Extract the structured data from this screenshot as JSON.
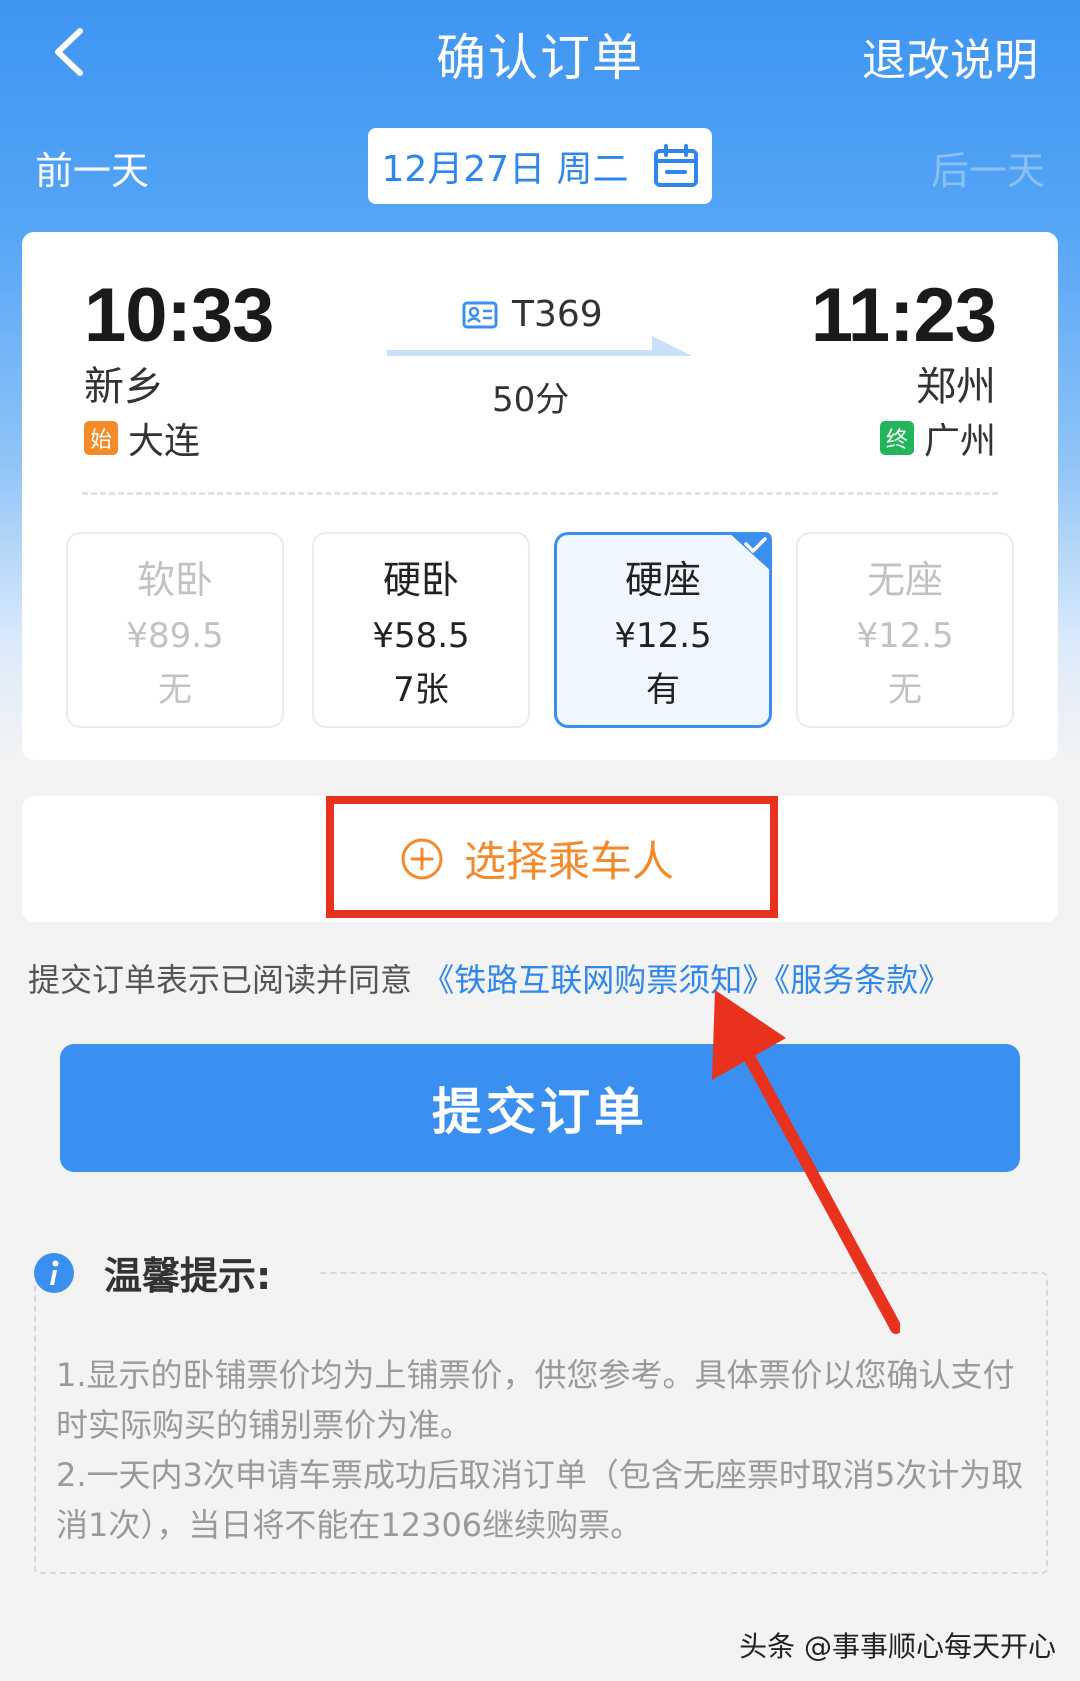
{
  "header": {
    "title": "确认订单",
    "refund_link": "退改说明",
    "prev_day": "前一天",
    "next_day": "后一天",
    "date": "12月27日 周二"
  },
  "train": {
    "depart_time": "10:33",
    "depart_station": "新乡",
    "origin_tag": "始",
    "origin_station": "大连",
    "train_number": "T369",
    "duration": "50分",
    "arrive_time": "11:23",
    "arrive_station": "郑州",
    "terminal_tag": "终",
    "terminal_station": "广州"
  },
  "seats": [
    {
      "name": "软卧",
      "price": "¥89.5",
      "availability": "无",
      "state": "disabled"
    },
    {
      "name": "硬卧",
      "price": "¥58.5",
      "availability": "7张",
      "state": "normal"
    },
    {
      "name": "硬座",
      "price": "¥12.5",
      "availability": "有",
      "state": "selected"
    },
    {
      "name": "无座",
      "price": "¥12.5",
      "availability": "无",
      "state": "disabled"
    }
  ],
  "passenger": {
    "add_label": "选择乘车人"
  },
  "agreement": {
    "prefix": "提交订单表示已阅读并同意",
    "link1": "《铁路互联网购票须知》",
    "link2": "《服务条款》"
  },
  "submit_label": "提交订单",
  "tips": {
    "title": "温馨提示:",
    "line1": "1.显示的卧铺票价均为上铺票价，供您参考。具体票价以您确认支付时实际购买的铺别票价为准。",
    "line2": "2.一天内3次申请车票成功后取消订单（包含无座票时取消5次计为取消1次），当日将不能在12306继续购票。"
  },
  "watermark": "头条 @事事顺心每天开心",
  "colors": {
    "brand_blue": "#3a8ff0",
    "accent_orange": "#f38b2c",
    "annotation_red": "#e8321e"
  },
  "icons": {
    "back": "chevron-left-icon",
    "calendar": "calendar-icon",
    "train_id": "id-card-icon",
    "add": "plus-circle-icon",
    "check": "check-icon",
    "info": "info-icon"
  }
}
